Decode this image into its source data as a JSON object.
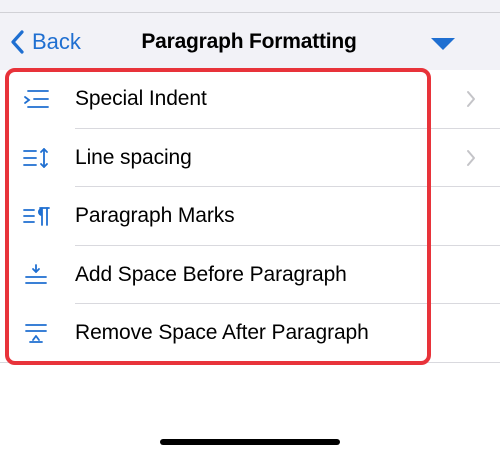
{
  "nav": {
    "back_label": "Back",
    "title": "Paragraph Formatting"
  },
  "items": [
    {
      "label": "Special Indent",
      "icon": "special-indent-icon",
      "has_chevron": true
    },
    {
      "label": "Line spacing",
      "icon": "line-spacing-icon",
      "has_chevron": true
    },
    {
      "label": "Paragraph Marks",
      "icon": "paragraph-marks-icon",
      "has_chevron": false
    },
    {
      "label": "Add Space Before Paragraph",
      "icon": "add-space-before-icon",
      "has_chevron": false
    },
    {
      "label": "Remove Space After Paragraph",
      "icon": "remove-space-after-icon",
      "has_chevron": false
    }
  ],
  "colors": {
    "accent": "#1f6fd1",
    "highlight": "#e8333a",
    "nav_background": "#f2f2f7"
  }
}
